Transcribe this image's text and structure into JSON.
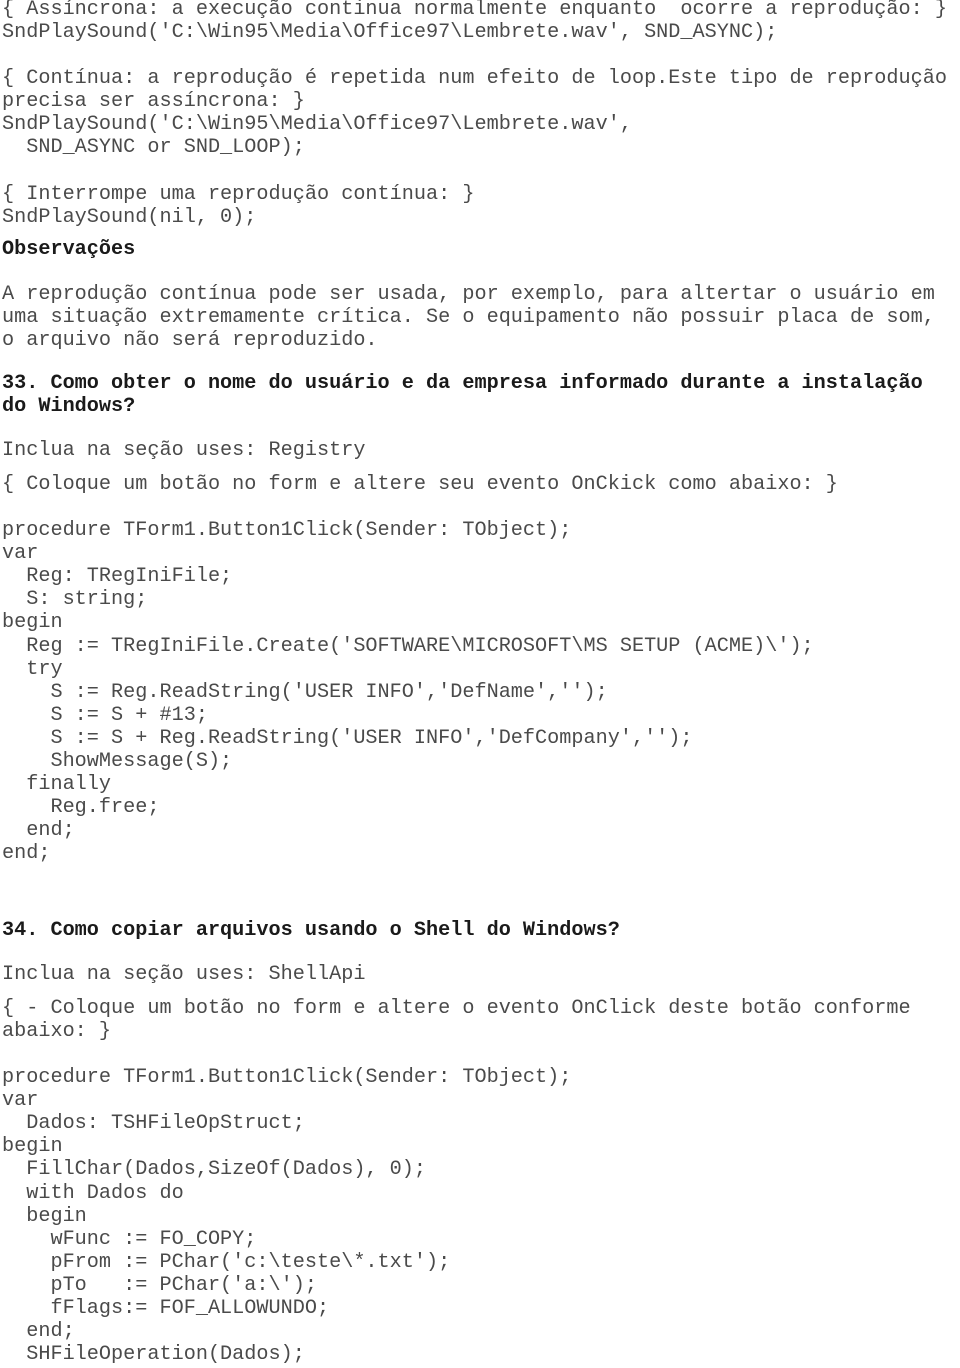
{
  "document": {
    "block_async": [
      "{ Assíncrona: a execução continua normalmente enquanto  ocorre a reprodução: }",
      "SndPlaySound('C:\\Win95\\Media\\Office97\\Lembrete.wav', SND_ASYNC);"
    ],
    "block_loop": [
      "{ Contínua: a reprodução é repetida num efeito de loop.Este tipo de reprodução",
      "precisa ser assíncrona: }",
      "SndPlaySound('C:\\Win95\\Media\\Office97\\Lembrete.wav',",
      "  SND_ASYNC or SND_LOOP);"
    ],
    "block_stop": [
      "{ Interrompe uma reprodução contínua: }",
      "SndPlaySound(nil, 0);"
    ],
    "observacoes_heading": "Observações",
    "observacoes_text": [
      "A reprodução contínua pode ser usada, por exemplo, para altertar o usuário em",
      "uma situação extremamente crítica. Se o equipamento não possuir placa de som,",
      "o arquivo não será reproduzido."
    ],
    "section33": {
      "heading": [
        "33. Como obter o nome do usuário e da empresa informado durante a instalação",
        "do Windows?"
      ],
      "uses": "Inclua na seção uses: Registry",
      "comment": "{ Coloque um botão no form e altere seu evento OnCkick como abaixo: }",
      "code": [
        "procedure TForm1.Button1Click(Sender: TObject);",
        "var",
        "  Reg: TRegIniFile;",
        "  S: string;",
        "begin",
        "  Reg := TRegIniFile.Create('SOFTWARE\\MICROSOFT\\MS SETUP (ACME)\\');",
        "  try",
        "    S := Reg.ReadString('USER INFO','DefName','');",
        "    S := S + #13;",
        "    S := S + Reg.ReadString('USER INFO','DefCompany','');",
        "    ShowMessage(S);",
        "  finally",
        "    Reg.free;",
        "  end;",
        "end;"
      ]
    },
    "section34": {
      "heading": "34. Como copiar arquivos usando o Shell do Windows?",
      "uses": "Inclua na seção uses: ShellApi",
      "comment": [
        "{ - Coloque um botão no form e altere o evento OnClick deste botão conforme",
        "abaixo: }"
      ],
      "code": [
        "procedure TForm1.Button1Click(Sender: TObject);",
        "var",
        "  Dados: TSHFileOpStruct;",
        "begin",
        "  FillChar(Dados,SizeOf(Dados), 0);",
        "  with Dados do",
        "  begin",
        "    wFunc := FO_COPY;",
        "    pFrom := PChar('c:\\teste\\*.txt');",
        "    pTo   := PChar('a:\\');",
        "    fFlags:= FOF_ALLOWUNDO;",
        "  end;",
        "  SHFileOperation(Dados);"
      ]
    }
  }
}
